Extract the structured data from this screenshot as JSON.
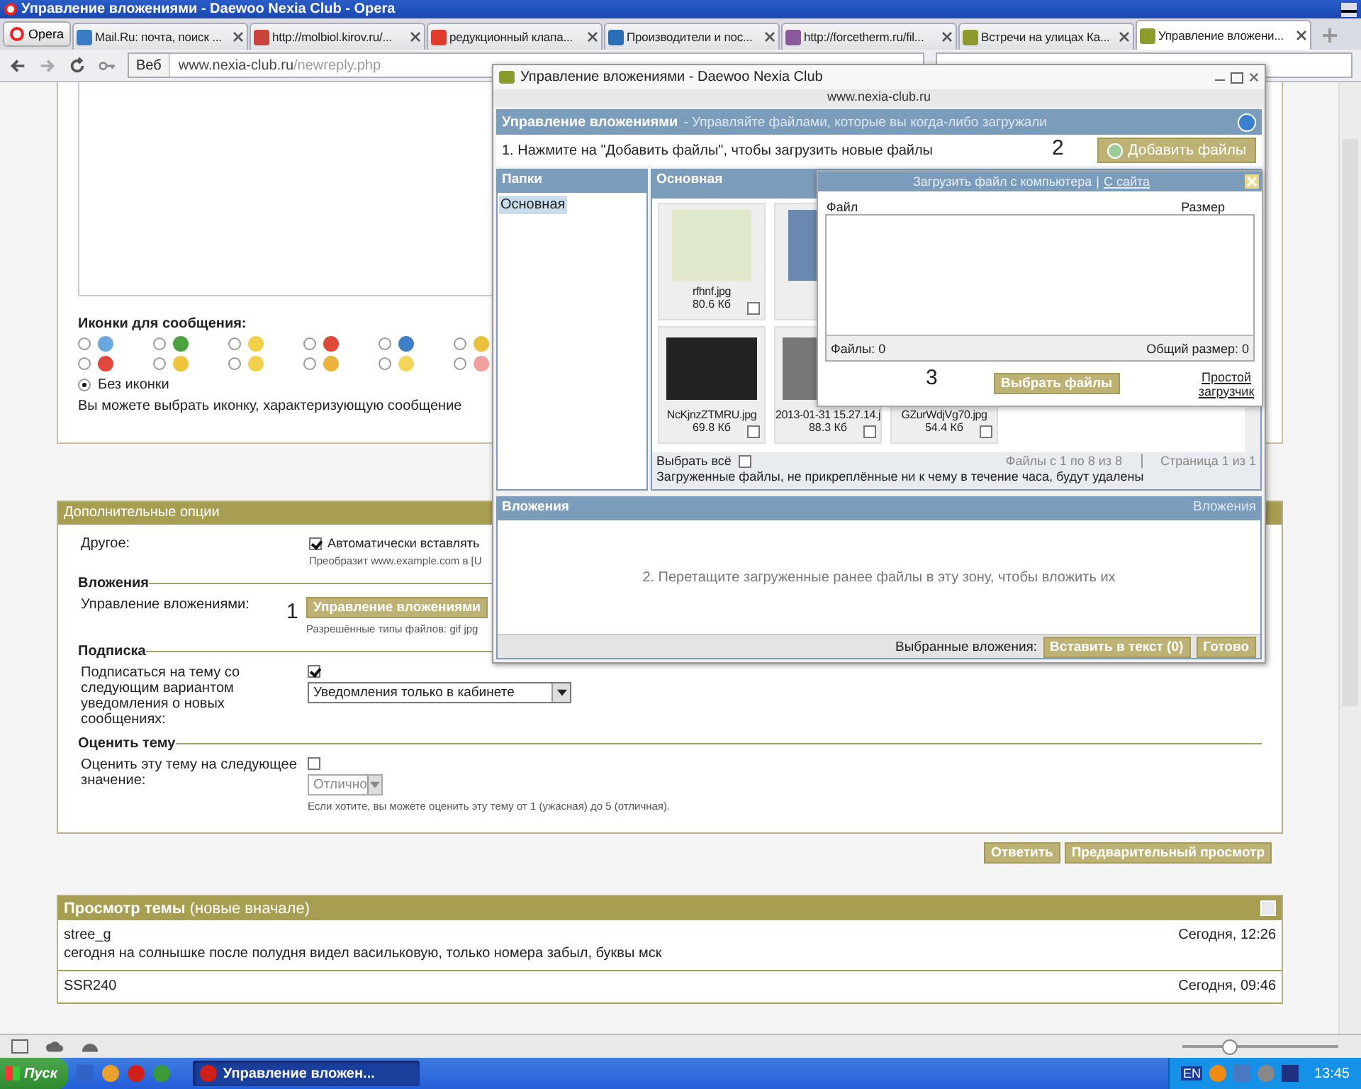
{
  "browser": {
    "title": "Управление вложениями - Daewoo Nexia Club - Opera",
    "menu_button": "Opera",
    "tabs": [
      {
        "label": "Mail.Ru: почта, поиск ...",
        "color": "#3b7cc4",
        "selected": false
      },
      {
        "label": "http://molbiol.kirov.ru/...",
        "color": "#c8443a",
        "selected": false
      },
      {
        "label": "редукционный клапа...",
        "color": "#e03c2c",
        "selected": false
      },
      {
        "label": "Производители и пос...",
        "color": "#2a6fb5",
        "selected": false
      },
      {
        "label": "http://forcetherm.ru/fil...",
        "color": "#8a5a9c",
        "selected": false
      },
      {
        "label": "Встречи на улицах Ка...",
        "color": "#8f9a2c",
        "selected": false
      },
      {
        "label": "Управление вложени...",
        "color": "#8f9a2c",
        "selected": true
      }
    ],
    "address": {
      "scheme": "Веб",
      "host": "www.nexia-club.ru",
      "path": "/newreply.php"
    }
  },
  "page": {
    "message_icons": {
      "title": "Иконки для сообщения:",
      "options": [
        {
          "color": "#6aa7e0",
          "selected": false
        },
        {
          "color": "#4aa33c",
          "selected": false
        },
        {
          "color": "#f2d04a",
          "selected": false
        },
        {
          "color": "#e04a3a",
          "selected": false
        },
        {
          "color": "#3d7fc8",
          "selected": false
        },
        {
          "color": "#e8c23a",
          "selected": false
        },
        {
          "color": "#e0483c",
          "selected": false
        },
        {
          "color": "#f0c53c",
          "selected": false
        },
        {
          "color": "#f3cf4e",
          "selected": false
        },
        {
          "color": "#eab238",
          "selected": false
        },
        {
          "color": "#f2d65a",
          "selected": false
        },
        {
          "color": "#f0a0a0",
          "selected": false
        }
      ],
      "no_icon": {
        "label": "Без иконки",
        "selected": true
      },
      "hint": "Вы можете выбрать иконку, характеризующую сообщение"
    },
    "extra_options": {
      "title": "Дополнительные опции",
      "links": {
        "label": "Другое:",
        "checked": true,
        "option": "Автоматически вставлять",
        "hint": "Преобразит www.example.com в [U"
      },
      "attachments": {
        "title": "Вложения",
        "label": "Управление вложениями:",
        "marker": "1",
        "button": "Управление вложениями",
        "hint": "Разрешённые типы файлов: gif jpg"
      },
      "subscription": {
        "title": "Подписка",
        "label": "Подписаться на тему со следующим вариантом уведомления о новых сообщениях:",
        "checked": true,
        "select": "Уведомления только в кабинете"
      },
      "rating": {
        "title": "Оценить тему",
        "label": "Оценить эту тему на следующее значение:",
        "checked": false,
        "select": "Отлично",
        "disabled": true,
        "hint": "Если хотите, вы можете оценить эту тему от 1 (ужасная) до 5 (отличная)."
      }
    },
    "actions": [
      "Ответить",
      "Предварительный просмотр"
    ],
    "topic_review": {
      "title": "Просмотр темы",
      "subtitle": "(новые вначале)",
      "posts": [
        {
          "author": "stree_g",
          "time": "Сегодня, 12:26",
          "text": "сегодня на солнышке после полудня видел васильковую, только номера забыл, буквы мск"
        },
        {
          "author": "SSR240",
          "time": "Сегодня, 09:46"
        }
      ]
    }
  },
  "popup": {
    "title": "Управление вложениями - Daewoo Nexia Club",
    "url": "www.nexia-club.ru",
    "header": {
      "title": "Управление вложениями",
      "subtitle": "- Управляйте файлами, которые вы когда-либо загружали"
    },
    "step": {
      "text": "1. Нажмите на \"Добавить файлы\", чтобы загрузить новые файлы",
      "marker": "2",
      "button": "Добавить файлы"
    },
    "folders": {
      "title": "Папки",
      "items": [
        {
          "label": "Основная",
          "selected": true
        }
      ]
    },
    "files": {
      "title": "Основная",
      "rows": [
        [
          {
            "kind": "map",
            "name": "rfhnf.jpg",
            "size": "80.6 Кб",
            "checked": false
          },
          {
            "kind": "screenshot"
          }
        ],
        [
          {
            "kind": "dark",
            "name": "NcKjnzZTMRU.jpg",
            "size": "69.8 Кб",
            "checked": false
          },
          {
            "kind": "photo",
            "name": "2013-01-31 15.27.14.j",
            "size": "88.3 Кб",
            "checked": false
          },
          {
            "kind": "photo",
            "name": "GZurWdjVg70.jpg",
            "size": "54.4 Кб",
            "checked": false
          }
        ]
      ],
      "select_all": {
        "label": "Выбрать всё",
        "checked": false
      },
      "range": "Файлы с 1 по 8 из 8",
      "page": "Страница 1 из 1",
      "notice": "Загруженные файлы, не прикреплённые ни к чему в течение часа, будут удалены"
    },
    "attachments": {
      "title": "Вложения",
      "link": "Вложения",
      "drop_hint": "2. Перетащите загруженные ранее файлы в эту зону, чтобы вложить их",
      "selected_label": "Выбранные вложения:",
      "buttons": [
        "Вставить в текст (0)",
        "Готово"
      ]
    },
    "upload": {
      "title": "Загрузить файл с компьютера",
      "separator": "|",
      "site_link": "С сайта",
      "columns": [
        "Файл",
        "Размер"
      ],
      "count": "Файлы: 0",
      "total": "Общий размер: 0",
      "marker": "3",
      "button": "Выбрать файлы",
      "simple_link": "Простой загрузчик"
    }
  },
  "status_bar": {
    "zoom": {
      "level": 0.3
    }
  },
  "taskbar": {
    "start": "Пуск",
    "tasks": [
      {
        "label": "Управление вложен...",
        "selected": true
      }
    ],
    "language": "EN",
    "clock": "13:45"
  }
}
